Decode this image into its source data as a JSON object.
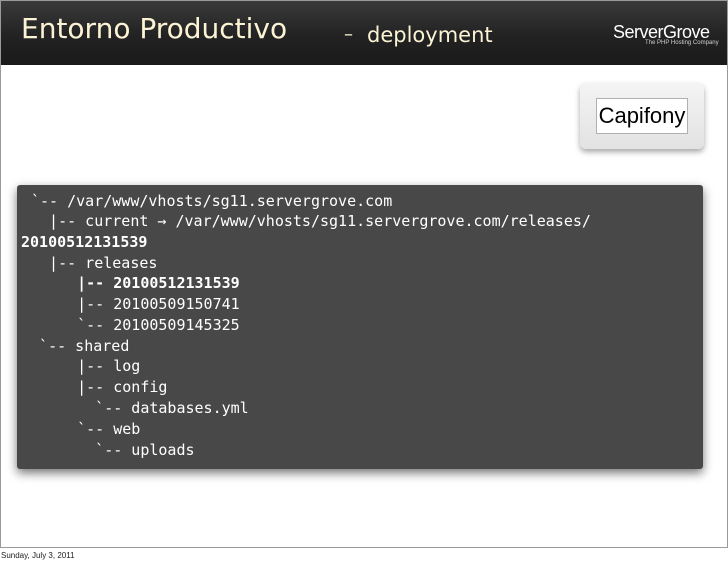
{
  "header": {
    "title": "Entorno Productivo",
    "dash": "–",
    "subtitle": "deployment"
  },
  "logo": {
    "name": "ServerGrove",
    "tagline": "The PHP Hosting Company"
  },
  "badge": {
    "label": "Capifony"
  },
  "tree": {
    "lines": [
      "`-- /var/www/vhosts/sg11.servergrove.com",
      "  |-- current → /var/www/vhosts/sg11.servergrove.com/releases/",
      "20100512131539",
      "  |-- releases",
      "    |-- 20100512131539",
      "    |-- 20100509150741",
      "    `-- 20100509145325",
      "  `-- shared",
      "    |-- log",
      "    |-- config",
      "      `-- databases.yml",
      "    `-- web",
      "      `-- uploads"
    ]
  },
  "footer": {
    "date": "Sunday, July 3, 2011"
  },
  "colors": {
    "header_bg": "#222222",
    "title_text": "#fbf3d4",
    "code_bg": "#484848",
    "code_text": "#ffffff"
  }
}
